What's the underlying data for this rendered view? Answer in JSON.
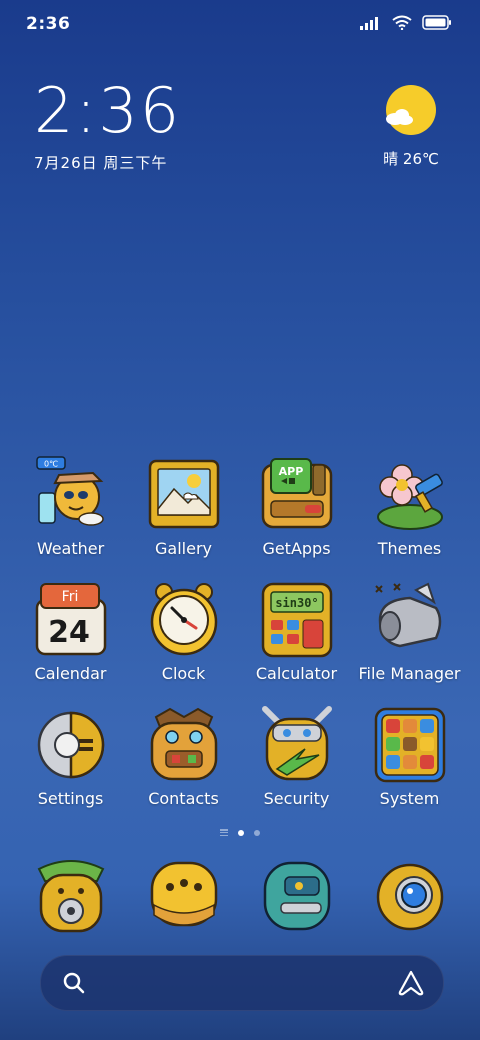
{
  "status_bar": {
    "time": "2:36",
    "signal_icon": "cellular-signal-icon",
    "wifi_icon": "wifi-icon",
    "battery_icon": "battery-icon"
  },
  "clock_widget": {
    "time": "2:36",
    "date": "7月26日 周三下午"
  },
  "weather_widget": {
    "condition_temp": "晴 26℃",
    "icon": "sunny-cloud-icon"
  },
  "apps": [
    {
      "label": "Weather",
      "icon": "weather-icon"
    },
    {
      "label": "Gallery",
      "icon": "gallery-icon"
    },
    {
      "label": "GetApps",
      "icon": "getapps-icon",
      "icon_text": "APP"
    },
    {
      "label": "Themes",
      "icon": "themes-icon"
    },
    {
      "label": "Calendar",
      "icon": "calendar-icon",
      "day_name": "Fri",
      "day_number": "24"
    },
    {
      "label": "Clock",
      "icon": "clock-icon"
    },
    {
      "label": "Calculator",
      "icon": "calculator-icon",
      "display_text": "sin30°"
    },
    {
      "label": "File Manager",
      "icon": "file-manager-icon"
    },
    {
      "label": "Settings",
      "icon": "settings-icon"
    },
    {
      "label": "Contacts",
      "icon": "contacts-icon"
    },
    {
      "label": "Security",
      "icon": "security-icon"
    },
    {
      "label": "System",
      "icon": "system-icon"
    }
  ],
  "weather_badge": "0℃",
  "pager": {
    "pages": 2,
    "active": 1
  },
  "dock": [
    {
      "icon": "phone-icon"
    },
    {
      "icon": "messages-icon"
    },
    {
      "icon": "browser-icon"
    },
    {
      "icon": "camera-icon"
    }
  ],
  "search": {
    "search_icon": "search-icon",
    "assistant_icon": "assistant-icon"
  },
  "colors": {
    "accent_yellow": "#f2c230",
    "background_top": "#1a3b8c",
    "background_mid": "#3a67b4"
  }
}
